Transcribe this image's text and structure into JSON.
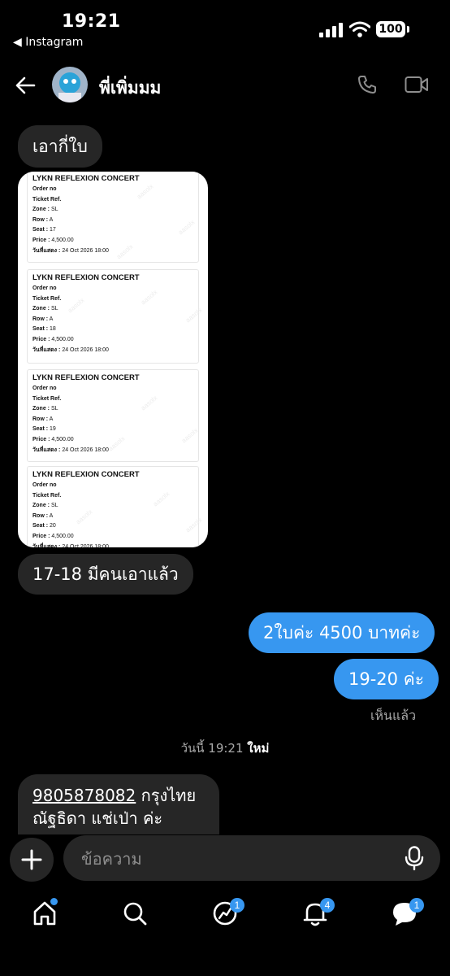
{
  "status": {
    "time": "19:21",
    "back_app": "◀ Instagram",
    "battery": "100"
  },
  "header": {
    "contact_name": "พี่เพิ่มมม"
  },
  "messages": {
    "m1": "เอากี่ใบ",
    "m2": "17-18 มีคนเอาแล้ว",
    "m3": "2ใบค่ะ 4500 บาทค่ะ",
    "m4": "19-20 ค่ะ",
    "seen": "เห็นแล้ว",
    "timestamp": "วันนี้ 19:21",
    "timestamp_new": "ใหม่",
    "m5_account": "9805878082",
    "m5_bank": " กรุงไทย",
    "m5_line2": "ณัฐธิดา แช่เป่า ค่ะ"
  },
  "tickets": {
    "title": "LYKN REFLEXION CONCERT",
    "order_label": "Order no",
    "ref_label": "Ticket Ref.",
    "zone_label": "Zone :",
    "row_label": "Row :",
    "seat_label": "Seat :",
    "price_label": "Price :",
    "date_label": "วันที่แสดง :",
    "zone": "SL",
    "row": "A",
    "price": "4,500.00",
    "date": "24 Oct 2026 18:00",
    "watermark": "aasolx",
    "items": [
      {
        "seat": "17"
      },
      {
        "seat": "18"
      },
      {
        "seat": "19"
      },
      {
        "seat": "20"
      }
    ]
  },
  "composer": {
    "placeholder": "ข้อความ"
  },
  "nav": {
    "messages_badge": "1",
    "notifications_badge": "4",
    "threads_badge": "1"
  }
}
